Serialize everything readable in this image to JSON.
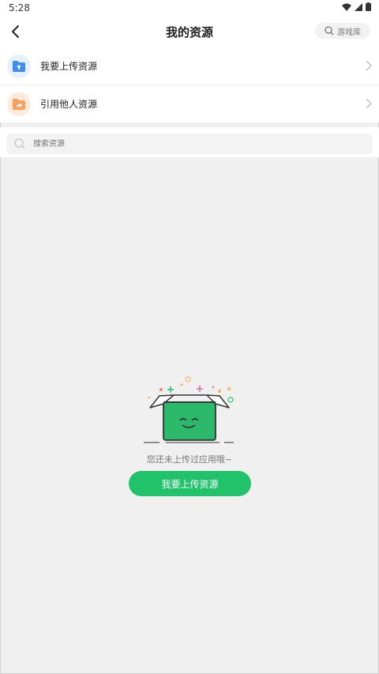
{
  "status_bar": {
    "time": "5:28",
    "icons": [
      "wifi-icon",
      "signal-icon",
      "battery-icon"
    ]
  },
  "header": {
    "title": "我的资源",
    "search_pill_label": "游戏库"
  },
  "menu": {
    "items": [
      {
        "label": "我要上传资源",
        "icon": "upload-folder-icon",
        "icon_bg": "#e6f0ff",
        "icon_color": "#3d8cf0"
      },
      {
        "label": "引用他人资源",
        "icon": "share-folder-icon",
        "icon_bg": "#ffe9d8",
        "icon_color": "#f5a25f"
      }
    ]
  },
  "search": {
    "placeholder": "搜索资源"
  },
  "empty_state": {
    "message": "您还未上传过应用哦~",
    "button_label": "我要上传资源",
    "accent_color": "#20c26a"
  }
}
